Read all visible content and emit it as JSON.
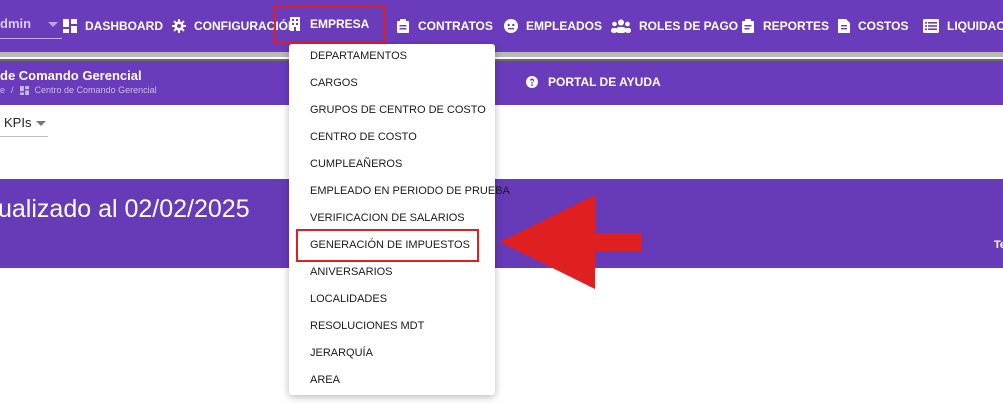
{
  "topnav": {
    "user_label": "dmin",
    "items": [
      {
        "label": "DASHBOARD",
        "icon": "dashboard-icon"
      },
      {
        "label": "CONFIGURACIÓN",
        "icon": "gear-icon"
      },
      {
        "label": "EMPRESA",
        "icon": "building-icon"
      },
      {
        "label": "CONTRATOS",
        "icon": "clipboard-icon"
      },
      {
        "label": "EMPLEADOS",
        "icon": "face-icon"
      },
      {
        "label": "ROLES DE PAGO",
        "icon": "people-icon"
      },
      {
        "label": "REPORTES",
        "icon": "assignment-icon"
      },
      {
        "label": "COSTOS",
        "icon": "receipt-icon"
      },
      {
        "label": "LIQUIDACIO",
        "icon": "list-icon"
      }
    ]
  },
  "header": {
    "title": "de Comando Gerencial",
    "breadcrumb_home": "e",
    "breadcrumb_sep": "/",
    "breadcrumb_current": "Centro de Comando Gerencial",
    "help_label": "PORTAL DE AYUDA"
  },
  "view_select": {
    "value": "KPIs"
  },
  "banner": {
    "text": "ualizado al 02/02/2025",
    "right_text": "Te"
  },
  "dropdown": {
    "items": [
      "DEPARTAMENTOS",
      "CARGOS",
      "GRUPOS DE CENTRO DE COSTO",
      "CENTRO DE COSTO",
      "CUMPLEAÑEROS",
      "EMPLEADO EN PERIODO DE PRUEBA",
      "VERIFICACION DE SALARIOS",
      "GENERACIÓN DE IMPUESTOS",
      "ANIVERSARIOS",
      "LOCALIDADES",
      "RESOLUCIONES MDT",
      "JERARQUÍA",
      "AREA"
    ]
  },
  "colors": {
    "brand": "#6a3cbc",
    "annotation": "#e02020"
  }
}
